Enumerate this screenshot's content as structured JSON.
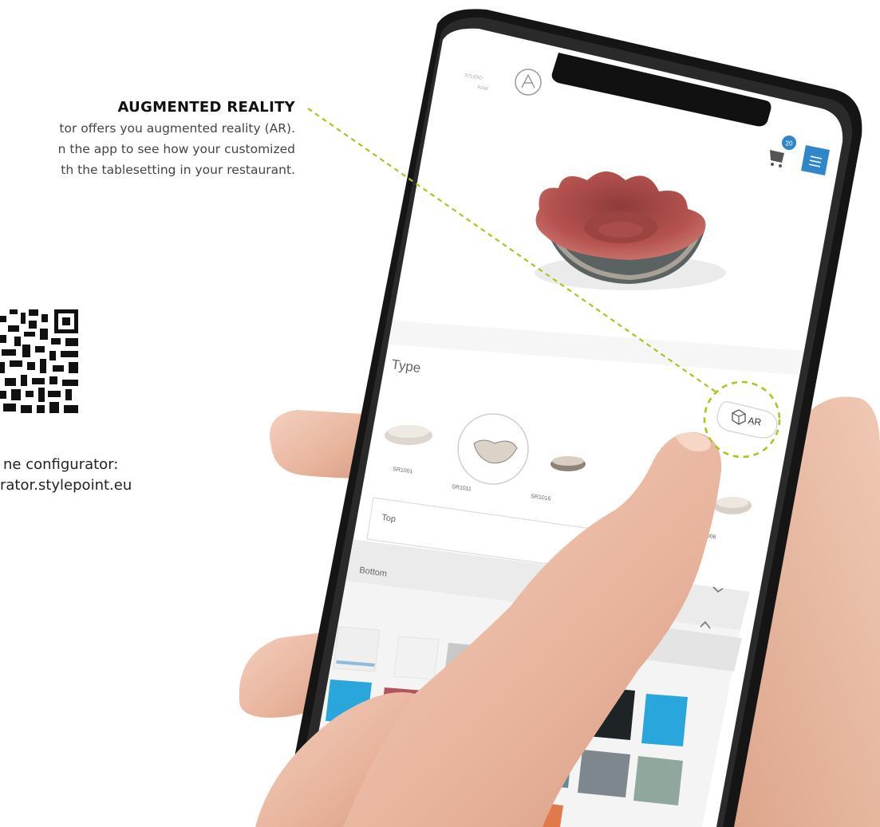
{
  "callout": {
    "title": "AUGMENTED REALITY",
    "lines": [
      "tor offers you augmented reality (AR).",
      "n the app to see how your customized",
      "th the tablesetting in your restaurant."
    ]
  },
  "configurator": {
    "line1": "ne configurator:",
    "line2": "rator.stylepoint.eu"
  },
  "app": {
    "cart_count": "20",
    "type_label": "Type",
    "ar_button": "AR",
    "products": [
      "SR1001",
      "SR1011",
      "SR1016",
      "SR1006"
    ],
    "sections": {
      "top": "Top",
      "bottom": "Bottom"
    }
  },
  "colors": {
    "accent_green": "#a8c520",
    "menu_blue": "#2f86c8",
    "bowl_red": "#b5524f",
    "swatch_blue": "#29a6dc",
    "swatch_red": "#b4545a",
    "swatch_black": "#1e2326",
    "swatch_orange": "#e07a4a"
  },
  "icons": [
    "logo-icon",
    "cart-icon",
    "hamburger-icon",
    "ar-cube-icon",
    "chevron-down-icon",
    "chevron-up-icon",
    "qr-code-icon"
  ]
}
